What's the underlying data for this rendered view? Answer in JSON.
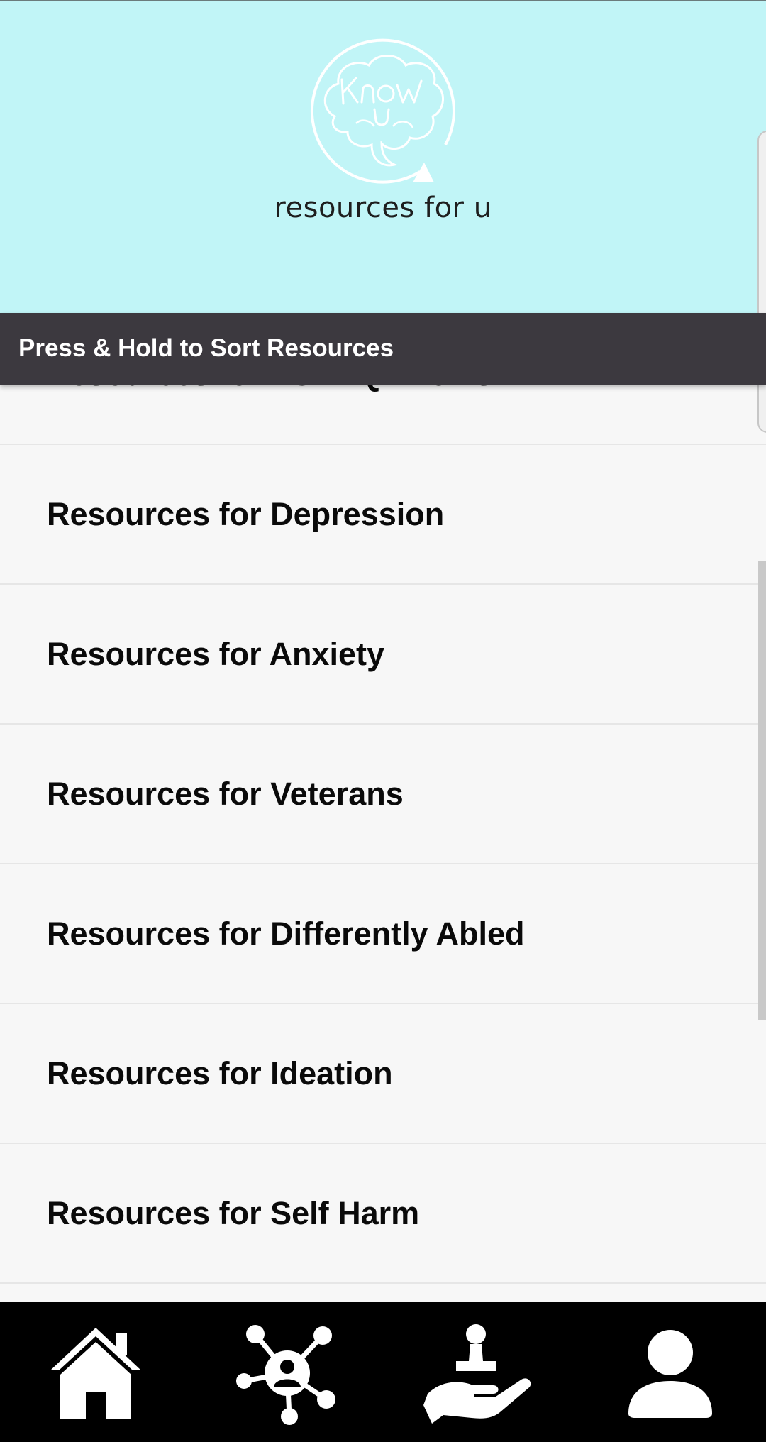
{
  "header": {
    "logo_text": "Know U",
    "title": "resources for u"
  },
  "sort_bar": {
    "label": "Press & Hold to Sort Resources"
  },
  "resources": [
    {
      "label": "Resources for LGBTQ+ Folks"
    },
    {
      "label": "Resources for Depression"
    },
    {
      "label": "Resources for Anxiety"
    },
    {
      "label": "Resources for Veterans"
    },
    {
      "label": "Resources for Differently Abled"
    },
    {
      "label": "Resources for Ideation"
    },
    {
      "label": "Resources for Self Harm"
    }
  ],
  "bottom_nav": [
    {
      "icon": "home-icon"
    },
    {
      "icon": "network-icon"
    },
    {
      "icon": "helping-hand-icon"
    },
    {
      "icon": "profile-icon"
    }
  ],
  "colors": {
    "header_bg": "#c1f5f7",
    "sort_bar_bg": "#3c393f",
    "list_bg": "#f7f7f7",
    "nav_bg": "#000000"
  }
}
